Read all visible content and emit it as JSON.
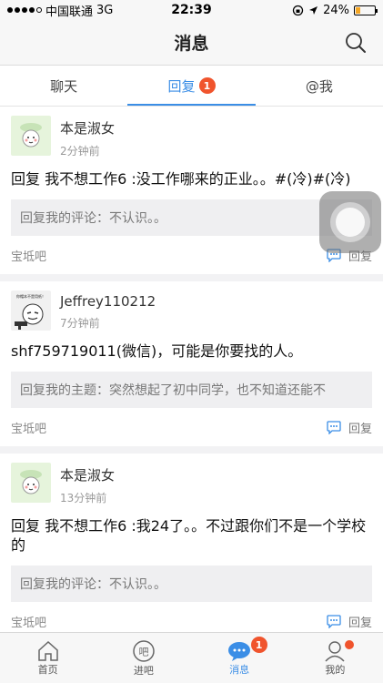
{
  "status": {
    "carrier": "中国联通",
    "network": "3G",
    "time": "22:39",
    "battery": "24%",
    "battery_level": 0.24
  },
  "header": {
    "title": "消息"
  },
  "tabs": [
    {
      "label": "聊天"
    },
    {
      "label": "回复",
      "badge": "1"
    },
    {
      "label": "@我"
    }
  ],
  "items": [
    {
      "username": "本是淑女",
      "time": "2分钟前",
      "content": "回复 我不想工作6 :没工作哪来的正业。。#(冷)#(冷)",
      "quote": "回复我的评论：不认识。。",
      "forum": "宝坻吧",
      "reply_label": "回复"
    },
    {
      "username": "Jeffrey110212",
      "time": "7分钟前",
      "content": "shf759719011(微信)，可能是你要找的人。",
      "quote": "回复我的主题：突然想起了初中同学，也不知道还能不",
      "forum": "宝坻吧",
      "reply_label": "回复",
      "avatar_caption": "你帽本不是用纸！"
    },
    {
      "username": "本是淑女",
      "time": "13分钟前",
      "content": "回复 我不想工作6 :我24了。。不过跟你们不是一个学校的",
      "quote": "回复我的评论：不认识。。",
      "forum": "宝坻吧",
      "reply_label": "回复"
    }
  ],
  "tabbar": [
    {
      "label": "首页",
      "icon": "home-icon"
    },
    {
      "label": "进吧",
      "icon": "ba-icon"
    },
    {
      "label": "消息",
      "icon": "message-icon",
      "badge": "1"
    },
    {
      "label": "我的",
      "icon": "profile-icon"
    }
  ],
  "colors": {
    "accent": "#3b8ee6",
    "badge": "#f0542d"
  }
}
